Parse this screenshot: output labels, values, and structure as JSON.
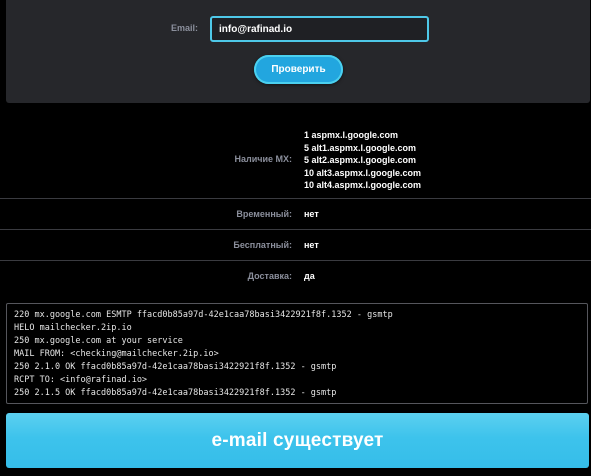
{
  "form": {
    "email_label": "Email:",
    "email_value": "info@rafinad.io",
    "submit_label": "Проверить"
  },
  "results": {
    "mx": {
      "label": "Наличие MX:",
      "records": [
        "1 aspmx.l.google.com",
        "5 alt1.aspmx.l.google.com",
        "5 alt2.aspmx.l.google.com",
        "10 alt3.aspmx.l.google.com",
        "10 alt4.aspmx.l.google.com"
      ]
    },
    "temporary": {
      "label": "Временный:",
      "value": "нет"
    },
    "free": {
      "label": "Бесплатный:",
      "value": "нет"
    },
    "delivery": {
      "label": "Доставка:",
      "value": "да"
    }
  },
  "smtp_log": [
    "220 mx.google.com ESMTP ffacd0b85a97d-42e1caa78basi3422921f8f.1352 - gsmtp",
    "HELO mailchecker.2ip.io",
    "250 mx.google.com at your service",
    "MAIL FROM: <checking@mailchecker.2ip.io>",
    "250 2.1.0 OK ffacd0b85a97d-42e1caa78basi3422921f8f.1352 - gsmtp",
    "RCPT TO: <info@rafinad.io>",
    "250 2.1.5 OK ffacd0b85a97d-42e1caa78basi3422921f8f.1352 - gsmtp"
  ],
  "result_banner": "e-mail существует",
  "colors": {
    "background": "#000000",
    "panel": "#26272b",
    "accent": "#4ec8e8",
    "button": "#22a6df",
    "label": "#8b8f9c",
    "banner": "#3dc3ec"
  }
}
